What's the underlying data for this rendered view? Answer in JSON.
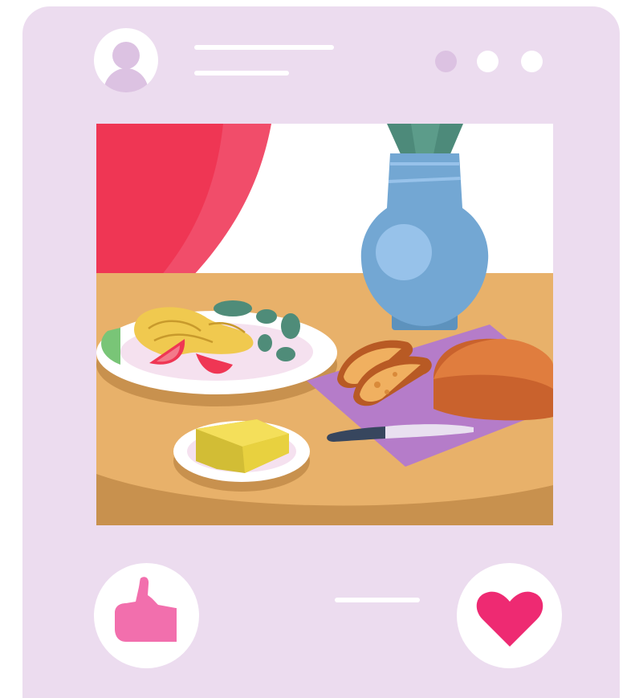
{
  "post": {
    "avatar_icon": "user-icon",
    "menu_dot_icons": [
      "dot-icon",
      "dot-icon",
      "dot-icon"
    ],
    "image_subject": "table-with-food-illustration"
  },
  "actions": {
    "like_icon": "thumbs-up-icon",
    "love_icon": "heart-icon"
  },
  "colors": {
    "card_bg": "#ecdcef",
    "avatar_silhouette": "#dcc2e2",
    "dot_muted": "#dcc2e2",
    "like_pink": "#f26fad",
    "heart_red": "#ee2a72",
    "table": "#e8b16a",
    "curtain": "#ef3654",
    "vase": "#73a7d3"
  }
}
